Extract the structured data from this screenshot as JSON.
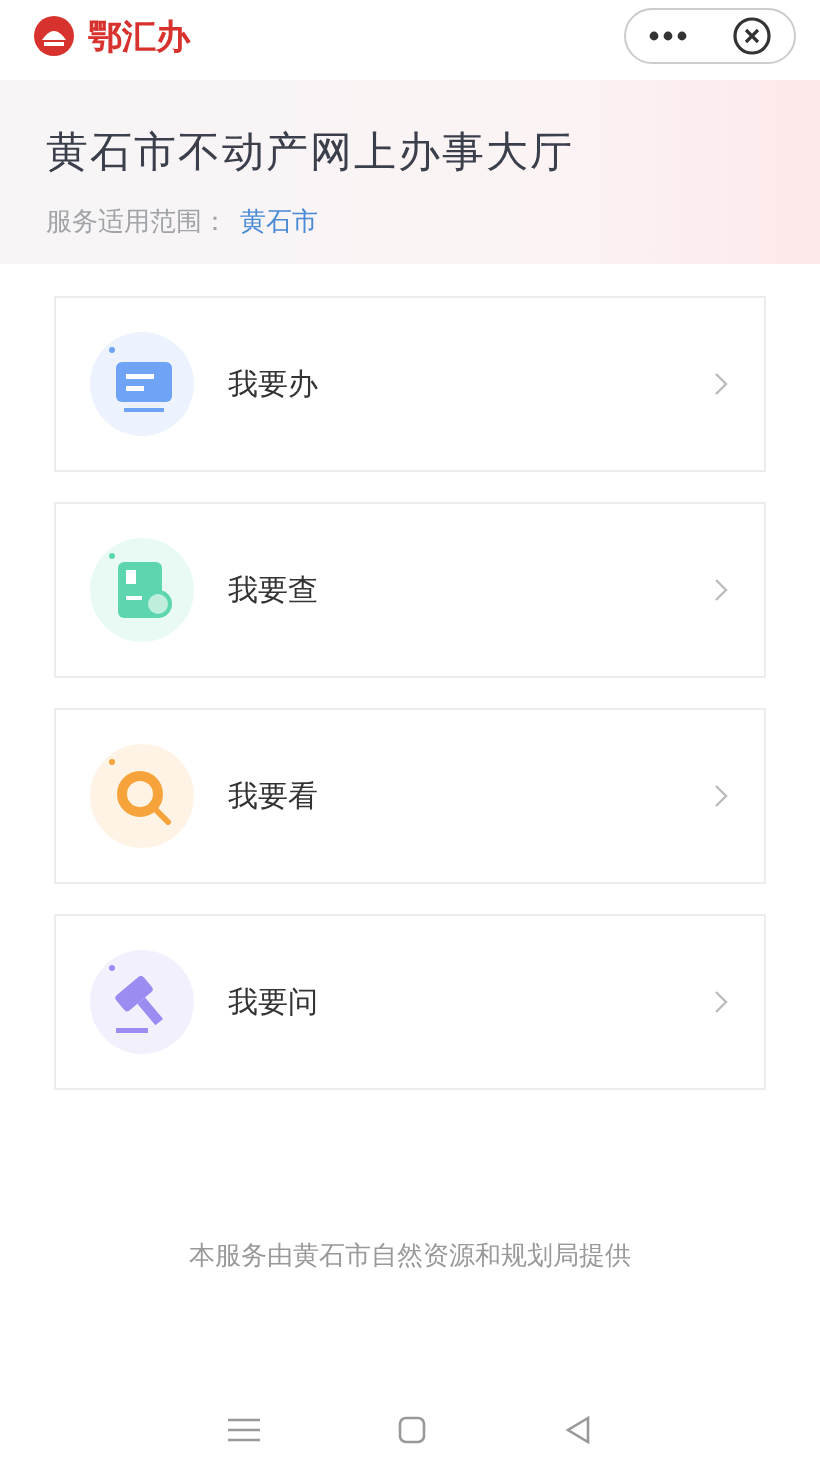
{
  "app_bar": {
    "brand": "鄂汇办"
  },
  "header": {
    "title": "黄石市不动产网上办事大厅",
    "scope_label": "服务适用范围：",
    "scope_value": "黄石市"
  },
  "menu": [
    {
      "label": "我要办",
      "kind": "handle",
      "color": "#6fa3f5"
    },
    {
      "label": "我要查",
      "kind": "query",
      "color": "#5dd6b0"
    },
    {
      "label": "我要看",
      "kind": "view",
      "color": "#f5a33a"
    },
    {
      "label": "我要问",
      "kind": "ask",
      "color": "#9b8cf2"
    }
  ],
  "footer": "本服务由黄石市自然资源和规划局提供"
}
